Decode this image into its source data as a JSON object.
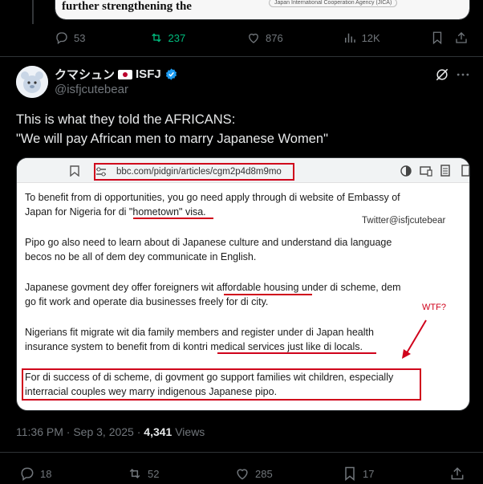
{
  "previous_post": {
    "card_line1": "further strengthening the",
    "card_org": "Japan International Cooperation Agency (JICA)",
    "replies": "53",
    "reposts": "237",
    "likes": "876",
    "views": "12K"
  },
  "post": {
    "display_name": "クマシュン",
    "name_suffix": "ISFJ",
    "handle": "@isfjcutebear",
    "text_line1": "This is what they told the AFRICANS:",
    "text_line2": "\"We will pay African men to marry Japanese Women\"",
    "timestamp": "11:36 PM · Sep 3, 2025 · ",
    "views_count": "4,341",
    "views_label": " Views",
    "replies": "18",
    "reposts": "52",
    "likes": "285",
    "bookmarks": "17"
  },
  "media": {
    "url": "bbc.com/pidgin/articles/cgm2p4d8m9mo",
    "watermark": "Twitter@isfjcutebear",
    "annotation": "WTF?",
    "paragraphs": [
      "To benefit from di opportunities, you go need apply through di website of Embassy of\nJapan for Nigeria for di \"hometown\" visa.",
      "Pipo go also need to learn about di Japanese culture and understand dia language\nbecos no be all of dem dey communicate in English.",
      "Japanese govment dey offer foreigners wit affordable housing under di scheme, dem\ngo fit work and operate dia businesses freely for di city.",
      "Nigerians fit migrate wit dia family members and register under di Japan health\ninsurance system to benefit from di kontri medical services just like di locals.",
      "For di success of di scheme, di govment go support families wit children, especially\ninterracial couples wey marry indigenous Japanese pipo."
    ]
  },
  "colors": {
    "accent_green": "#00ba7c",
    "annotation_red": "#d0021b",
    "verified_blue": "#1d9bf0"
  },
  "icons": [
    "reply-icon",
    "repost-icon",
    "like-icon",
    "views-icon",
    "bookmark-icon",
    "share-icon",
    "grok-icon",
    "more-icon",
    "verified-icon"
  ]
}
